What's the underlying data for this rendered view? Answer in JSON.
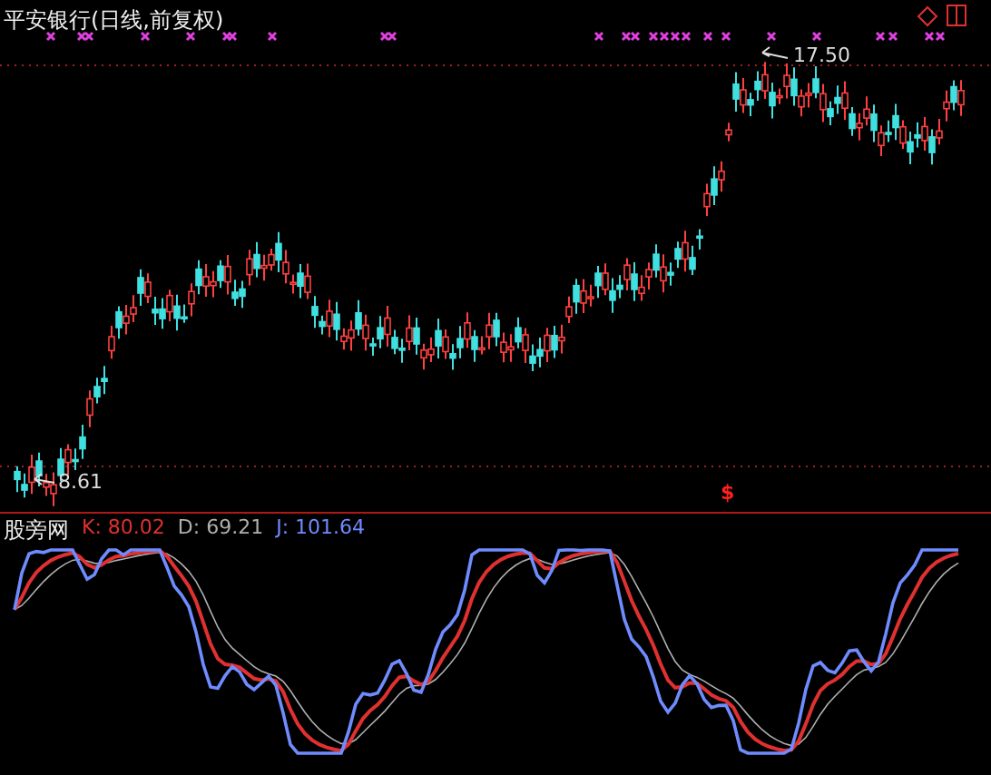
{
  "title": "平安银行(日线,前复权)",
  "price_labels": {
    "high": "17.50",
    "low": "8.61"
  },
  "signal_mark": "$",
  "indicator": {
    "name": "股旁网",
    "values": [
      {
        "label": "K: 80.02",
        "kind": "k"
      },
      {
        "label": "D: 69.21",
        "kind": "d"
      },
      {
        "label": "J: 101.64",
        "kind": "j"
      }
    ]
  }
}
